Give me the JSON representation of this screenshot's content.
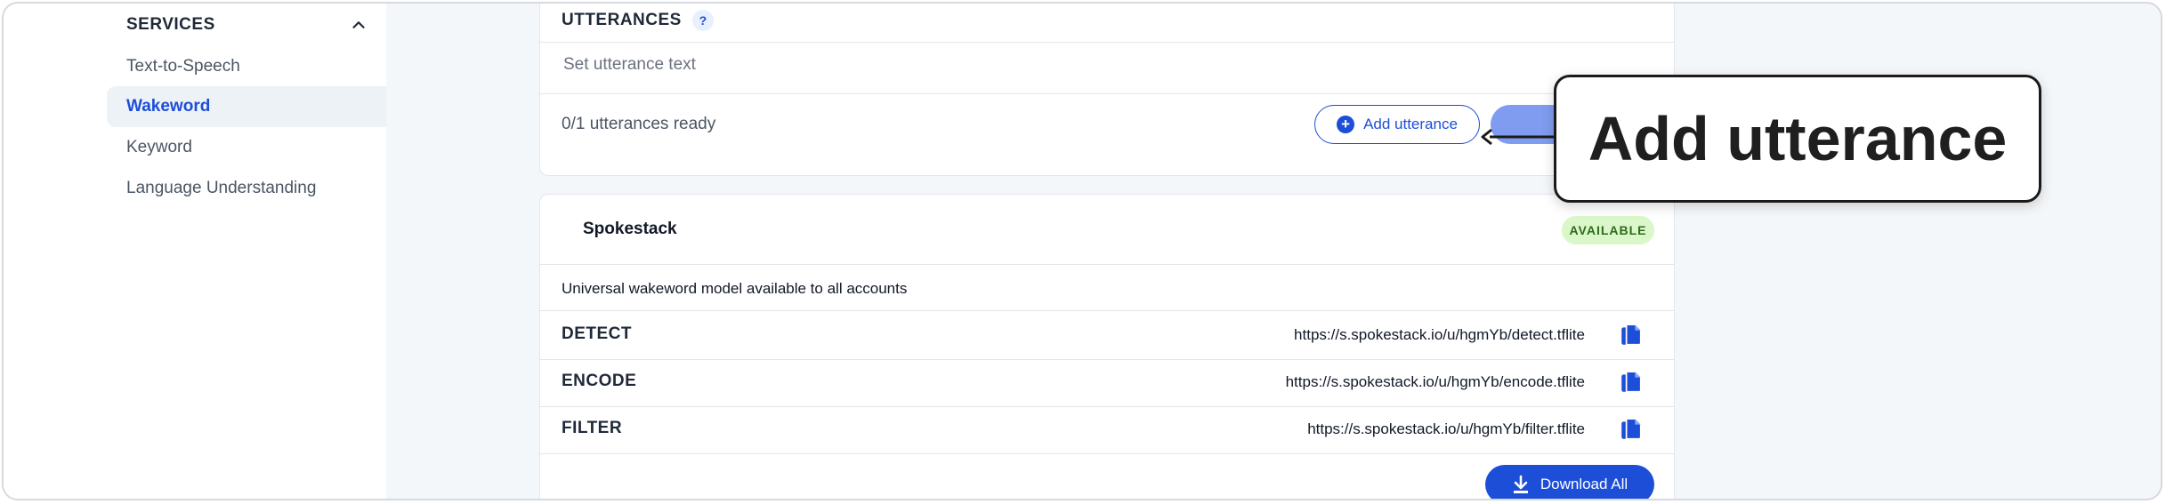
{
  "sidebar": {
    "section_title": "SERVICES",
    "items": [
      {
        "label": "Text-to-Speech",
        "active": false
      },
      {
        "label": "Wakeword",
        "active": true
      },
      {
        "label": "Keyword",
        "active": false
      },
      {
        "label": "Language Understanding",
        "active": false
      }
    ]
  },
  "utterances": {
    "title": "UTTERANCES",
    "help_label": "?",
    "input_placeholder": "Set utterance text",
    "status": "0/1 utterances ready",
    "add_button_label": "Add utterance"
  },
  "model": {
    "name": "Spokestack",
    "badge": "AVAILABLE",
    "description": "Universal wakeword model available to all accounts",
    "files": [
      {
        "label": "DETECT",
        "url": "https://s.spokestack.io/u/hgmYb/detect.tflite"
      },
      {
        "label": "ENCODE",
        "url": "https://s.spokestack.io/u/hgmYb/encode.tflite"
      },
      {
        "label": "FILTER",
        "url": "https://s.spokestack.io/u/hgmYb/filter.tflite"
      }
    ],
    "download_label": "Download All"
  },
  "callout": {
    "text": "Add utterance"
  },
  "colors": {
    "accent": "#1d4ed8",
    "available_bg": "#d9f7c8",
    "available_text": "#2f6b1a"
  }
}
